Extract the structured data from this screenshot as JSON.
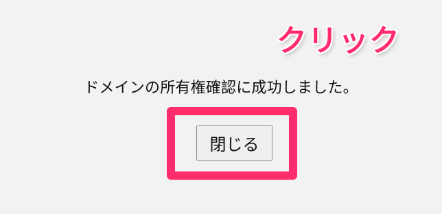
{
  "dialog": {
    "message": "ドメインの所有権確認に成功しました。",
    "close_label": "閉じる"
  },
  "annotation": {
    "callout_text": "クリック",
    "highlight_color": "#ff2d6d"
  },
  "colors": {
    "background": "#f2f2f2",
    "text": "#111111",
    "button_background": "#efefef",
    "button_border": "#8a8a8a"
  }
}
